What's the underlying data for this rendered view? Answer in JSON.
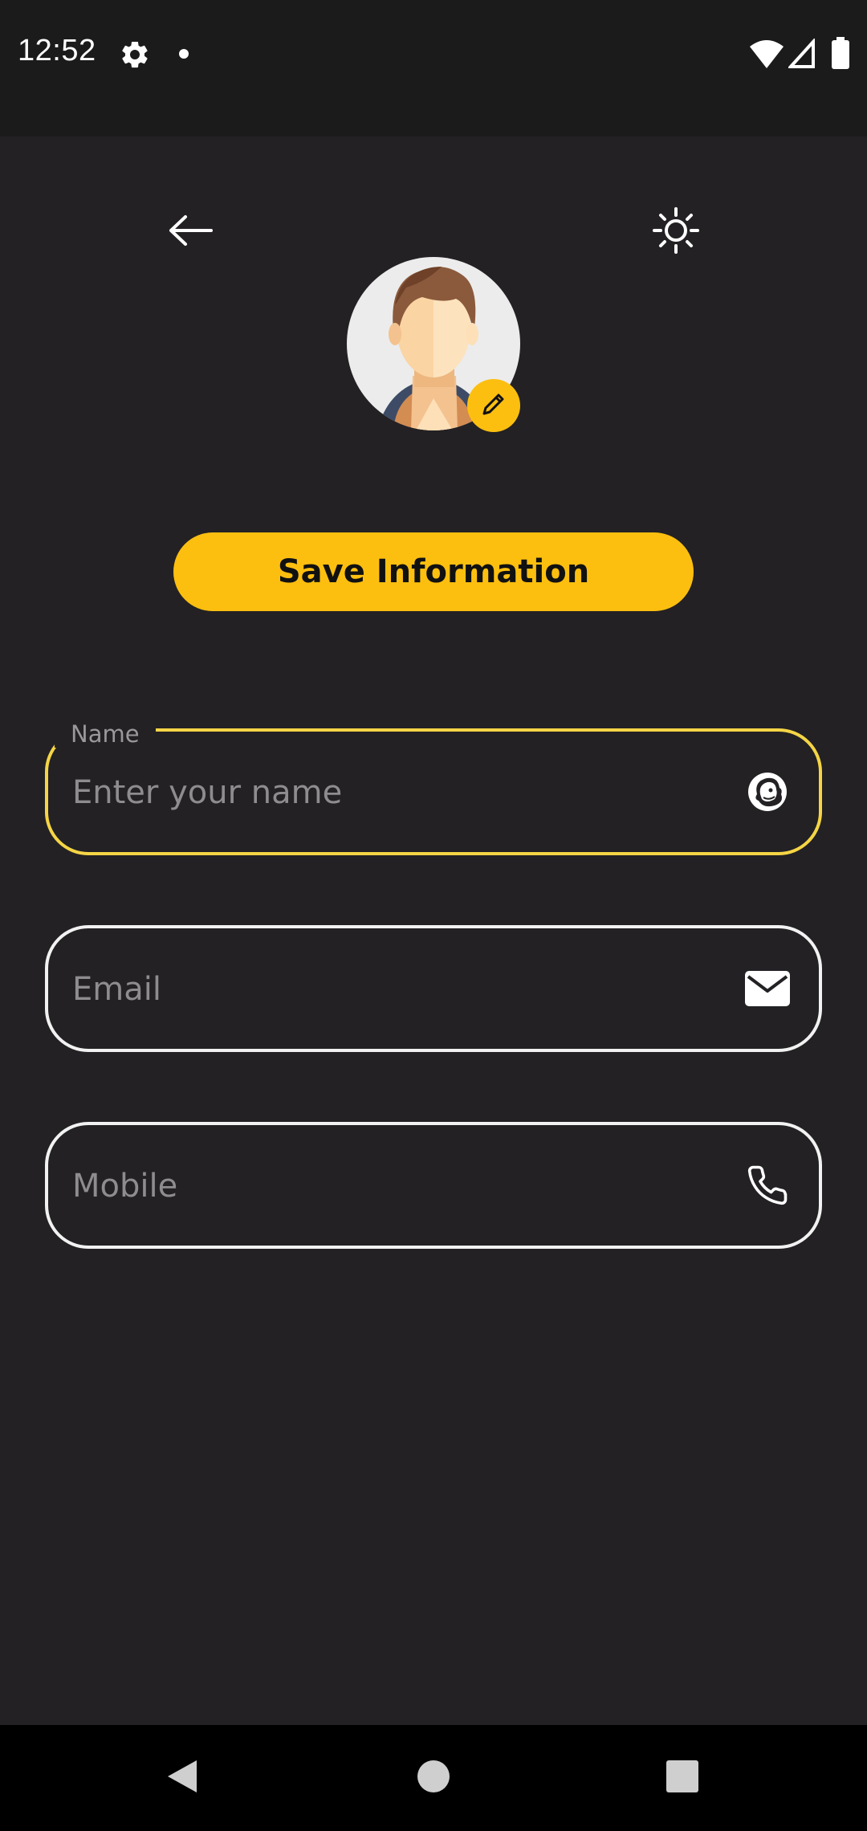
{
  "status_bar": {
    "time": "12:52",
    "icons": [
      "settings-icon",
      "notification-dot-icon",
      "wifi-icon",
      "signal-icon",
      "battery-icon"
    ]
  },
  "header": {
    "back_icon": "arrow-left-icon",
    "theme_icon": "sun-icon"
  },
  "profile": {
    "avatar": "avatar",
    "edit_icon": "pencil-icon"
  },
  "save_button": {
    "label": "Save Information"
  },
  "form": {
    "name": {
      "label": "Name",
      "placeholder": "Enter your name",
      "value": "",
      "icon": "mailchimp-icon"
    },
    "email": {
      "placeholder": "Email",
      "value": "",
      "icon": "envelope-icon"
    },
    "mobile": {
      "placeholder": "Mobile",
      "value": "",
      "icon": "phone-icon"
    }
  },
  "nav_bar": {
    "icons": [
      "back-triangle-icon",
      "home-circle-icon",
      "recents-square-icon"
    ]
  },
  "colors": {
    "accent": "#fdbf0f",
    "focus_border": "#f5d545",
    "background": "#232124",
    "status_bar": "#1c1b1c",
    "field_border": "#f2f2f2"
  }
}
